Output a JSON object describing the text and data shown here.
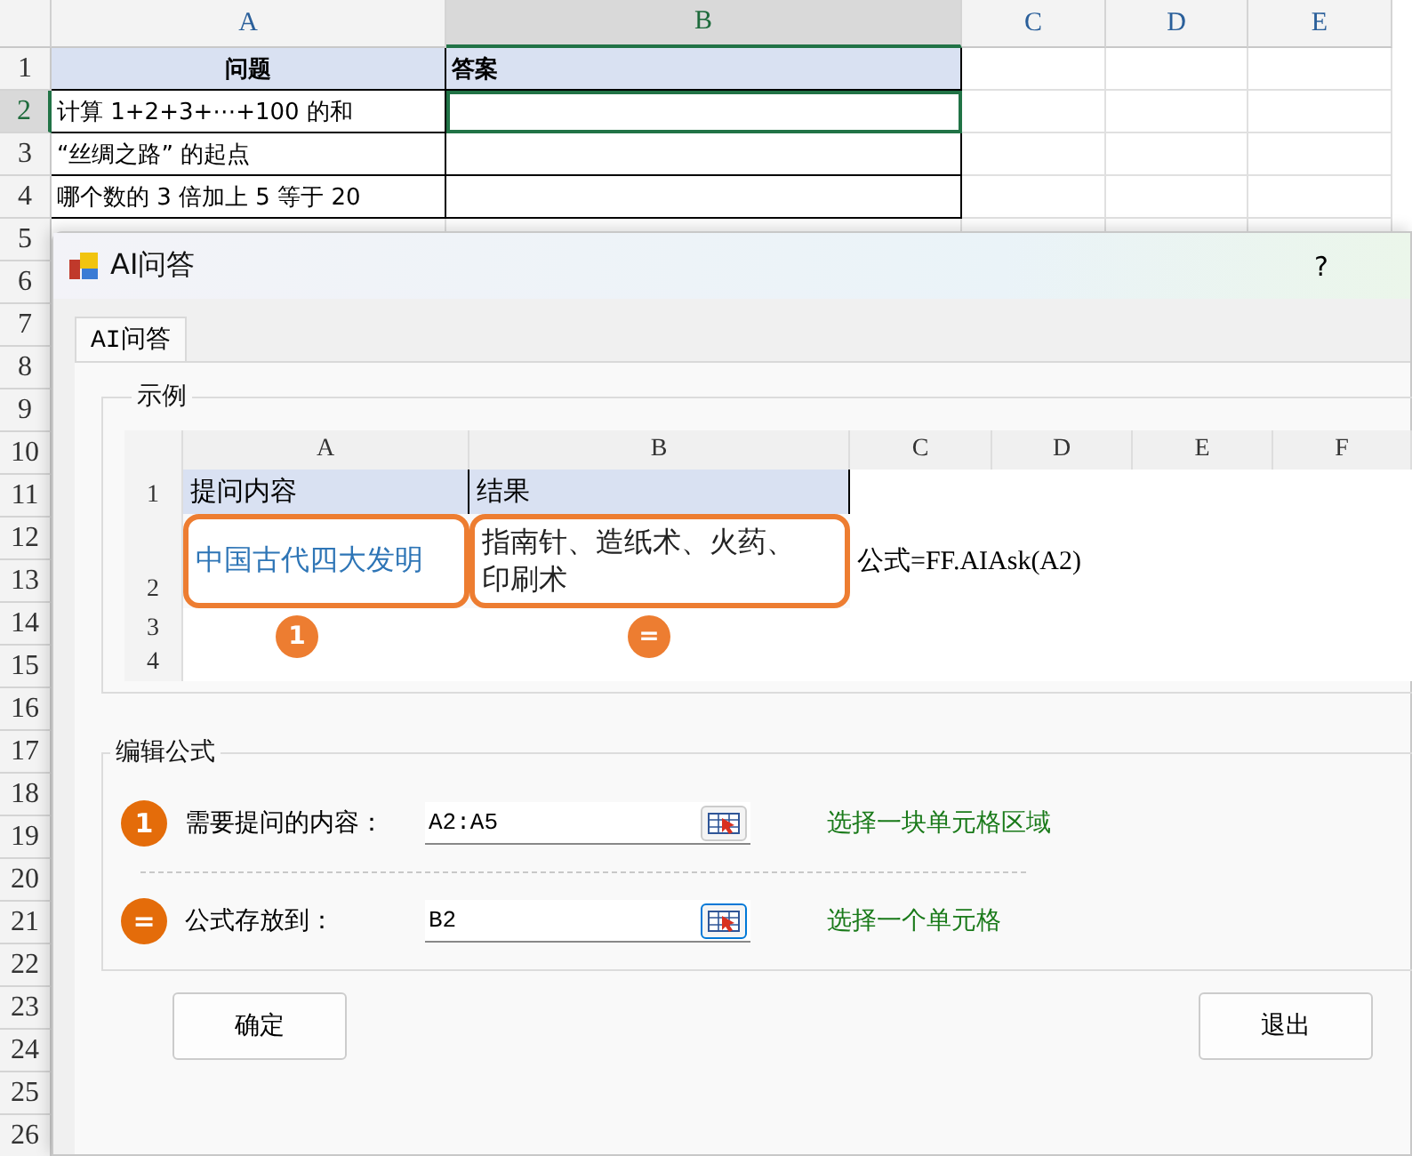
{
  "sheet": {
    "columns": [
      {
        "label": "A",
        "selected": false
      },
      {
        "label": "B",
        "selected": true
      },
      {
        "label": "C",
        "selected": false
      },
      {
        "label": "D",
        "selected": false
      },
      {
        "label": "E",
        "selected": false
      }
    ],
    "row_numbers": [
      {
        "label": "1",
        "selected": false
      },
      {
        "label": "2",
        "selected": true
      },
      {
        "label": "3",
        "selected": false
      },
      {
        "label": "4",
        "selected": false
      },
      {
        "label": "5",
        "selected": false
      },
      {
        "label": "6",
        "selected": false
      },
      {
        "label": "7",
        "selected": false
      },
      {
        "label": "8",
        "selected": false
      },
      {
        "label": "9",
        "selected": false
      },
      {
        "label": "10",
        "selected": false
      },
      {
        "label": "11",
        "selected": false
      },
      {
        "label": "12",
        "selected": false
      },
      {
        "label": "13",
        "selected": false
      },
      {
        "label": "14",
        "selected": false
      },
      {
        "label": "15",
        "selected": false
      },
      {
        "label": "16",
        "selected": false
      },
      {
        "label": "17",
        "selected": false
      },
      {
        "label": "18",
        "selected": false
      },
      {
        "label": "19",
        "selected": false
      },
      {
        "label": "20",
        "selected": false
      },
      {
        "label": "21",
        "selected": false
      },
      {
        "label": "22",
        "selected": false
      },
      {
        "label": "23",
        "selected": false
      },
      {
        "label": "24",
        "selected": false
      },
      {
        "label": "25",
        "selected": false
      },
      {
        "label": "26",
        "selected": false
      }
    ],
    "header": [
      "问题",
      "答案"
    ],
    "rows": [
      {
        "question": "计算 1+2+3+⋯+100 的和",
        "active": true
      },
      {
        "question": "“丝绸之路” 的起点",
        "active": false
      },
      {
        "question": "哪个数的 3 倍加上 5 等于 20",
        "active": false
      }
    ]
  },
  "dialog": {
    "title": "AI问答",
    "help": "?",
    "tabs": [
      {
        "label": "AI问答",
        "selected": true
      }
    ],
    "example": {
      "legend": "示例",
      "columns": [
        "A",
        "B",
        "C",
        "D",
        "E",
        "F"
      ],
      "row_numbers": [
        "1",
        "2",
        "3",
        "4"
      ],
      "header": [
        "提问内容",
        "结果"
      ],
      "question": "中国古代四大发明",
      "result": "指南针、造纸术、火药、印刷术",
      "formula_note": "公式=FF.AIAsk(A2)",
      "badges": [
        "1",
        "="
      ]
    },
    "edit": {
      "legend": "编辑公式",
      "fields": [
        {
          "badge": "1",
          "label": "需要提问的内容：",
          "value": "A2:A5",
          "hint": "选择一块单元格区域",
          "focused": false
        },
        {
          "badge": "=",
          "label": "公式存放到：",
          "value": "B2",
          "hint": "选择一个单元格",
          "focused": true
        }
      ]
    },
    "buttons": [
      "确定",
      "退出"
    ]
  }
}
